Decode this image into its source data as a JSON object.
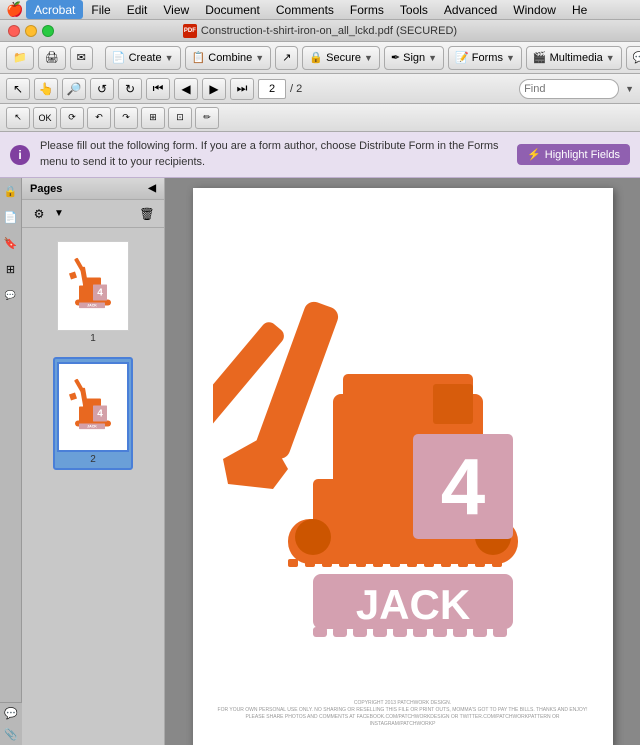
{
  "app": {
    "name": "Acrobat"
  },
  "menu_bar": {
    "apple": "🍎",
    "items": [
      "Acrobat",
      "File",
      "Edit",
      "View",
      "Document",
      "Comments",
      "Forms",
      "Tools",
      "Advanced",
      "Window",
      "He"
    ]
  },
  "title_bar": {
    "title": "Construction-t-shirt-iron-on_all_lckd.pdf (SECURED)"
  },
  "toolbar": {
    "create_label": "Create",
    "combine_label": "Combine",
    "secure_label": "Secure",
    "sign_label": "Sign",
    "forms_label": "Forms",
    "multimedia_label": "Multimedia",
    "comment_label": "Comment"
  },
  "nav_bar": {
    "page_current": "2",
    "page_total": "2",
    "find_placeholder": "Find"
  },
  "notification": {
    "text": "Please fill out the following form. If you are a form author, choose Distribute Form in the Forms menu to send it to your recipients.",
    "button_label": "Highlight Fields"
  },
  "sidebar": {
    "title": "Pages",
    "pages": [
      {
        "number": "1",
        "selected": false
      },
      {
        "number": "2",
        "selected": true
      }
    ]
  },
  "pdf": {
    "excavator_color": "#e86820",
    "number": "4",
    "name": "JACK",
    "name_bg": "#d4a0a8",
    "footer_text": "COPYRIGHT 2013 PATCHWORK DESIGN.\nFOR YOUR OWN PERSONAL USE ONLY. NO SHARING OR RESELLING THIS FILE OR PRINT OUTS, MOMMA'S GOT TO PAY THE BILLS. THANKS AND ENJOY!\nPLEASE SHARE PHOTOS AND COMMENTS AT FACEBOOK.COM/PATCHWORKDESIGN OR TWITTER.COM/PATCHWORKPATTERN OR INSTAGRAM/PATCHWORKP"
  }
}
